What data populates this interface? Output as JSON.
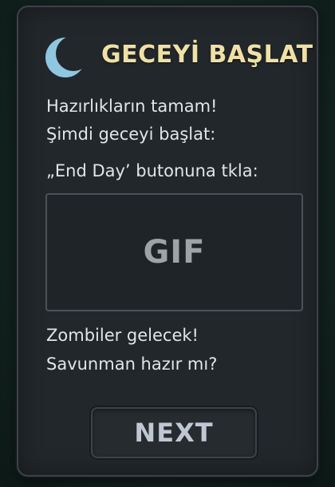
{
  "panel": {
    "title": "GECEYİ BAŞLAT",
    "icon": "crescent-moon-icon",
    "lines": [
      "Hazırlıkların tamam!",
      "Şimdi geceyi başlat:",
      "„End Day’ butonuna tkla:"
    ],
    "gif_placeholder": "GIF",
    "warning_lines": [
      "Zombiler gelecek!",
      "Savunman hazır mı?"
    ],
    "next_label": "NEXT"
  },
  "colors": {
    "title": "#efe1a5",
    "moon": "#8fc6e0",
    "panel_bg": "#22272b",
    "text": "#e2e5e8"
  }
}
